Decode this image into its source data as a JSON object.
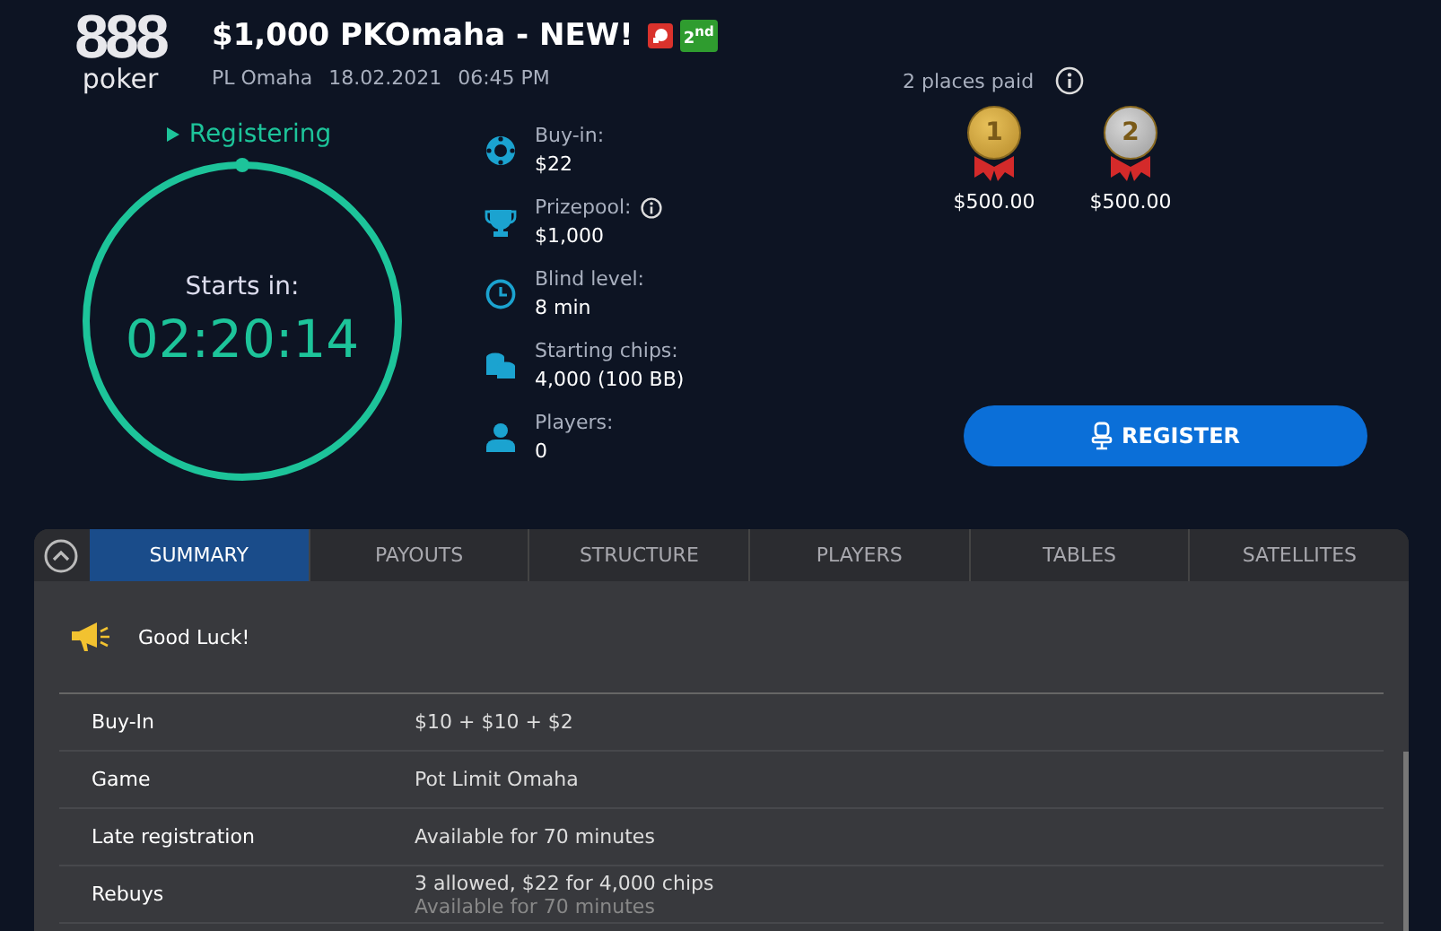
{
  "logo": {
    "digits": "888",
    "word": "poker"
  },
  "header": {
    "title": "$1,000 PKOmaha - NEW!",
    "badges": [
      {
        "kind": "knockout"
      },
      {
        "kind": "text",
        "text": "2$^{nd}$"
      }
    ],
    "game": "PL Omaha",
    "date": "18.02.2021",
    "time": "06:45 PM"
  },
  "status": "Registering",
  "timer": {
    "label": "Starts in:",
    "value": "02:20:14"
  },
  "info": [
    {
      "kind": "chip",
      "label": "Buy-in:",
      "value": "$22",
      "info": false
    },
    {
      "kind": "trophy",
      "label": "Prizepool:",
      "value": "$1,000",
      "info": true
    },
    {
      "kind": "clock",
      "label": "Blind level:",
      "value": "8 min",
      "info": false
    },
    {
      "kind": "stack",
      "label": "Starting chips:",
      "value": "4,000 (100 BB)",
      "info": false
    },
    {
      "kind": "player",
      "label": "Players:",
      "value": "0",
      "info": false
    }
  ],
  "payouts": {
    "title": "2 places paid",
    "places": [
      {
        "place": "1",
        "kind": "gold",
        "amount": "$500.00"
      },
      {
        "place": "2",
        "kind": "silver",
        "amount": "$500.00"
      }
    ]
  },
  "register_button": "REGISTER",
  "tabs": [
    {
      "label": "SUMMARY",
      "selected": true
    },
    {
      "label": "PAYOUTS",
      "selected": false
    },
    {
      "label": "STRUCTURE",
      "selected": false
    },
    {
      "label": "PLAYERS",
      "selected": false
    },
    {
      "label": "TABLES",
      "selected": false
    },
    {
      "label": "SATELLITES",
      "selected": false
    }
  ],
  "message": "Good Luck!",
  "details": [
    {
      "label": "Buy-In",
      "value": "$10 + $10 + $2"
    },
    {
      "label": "Game",
      "value": "Pot Limit Omaha"
    },
    {
      "label": "Late registration",
      "value": "Available for 70 minutes"
    },
    {
      "label": "Rebuys",
      "value": "3 allowed, $22 for 4,000 chips",
      "note": "Available for 70 minutes"
    }
  ]
}
